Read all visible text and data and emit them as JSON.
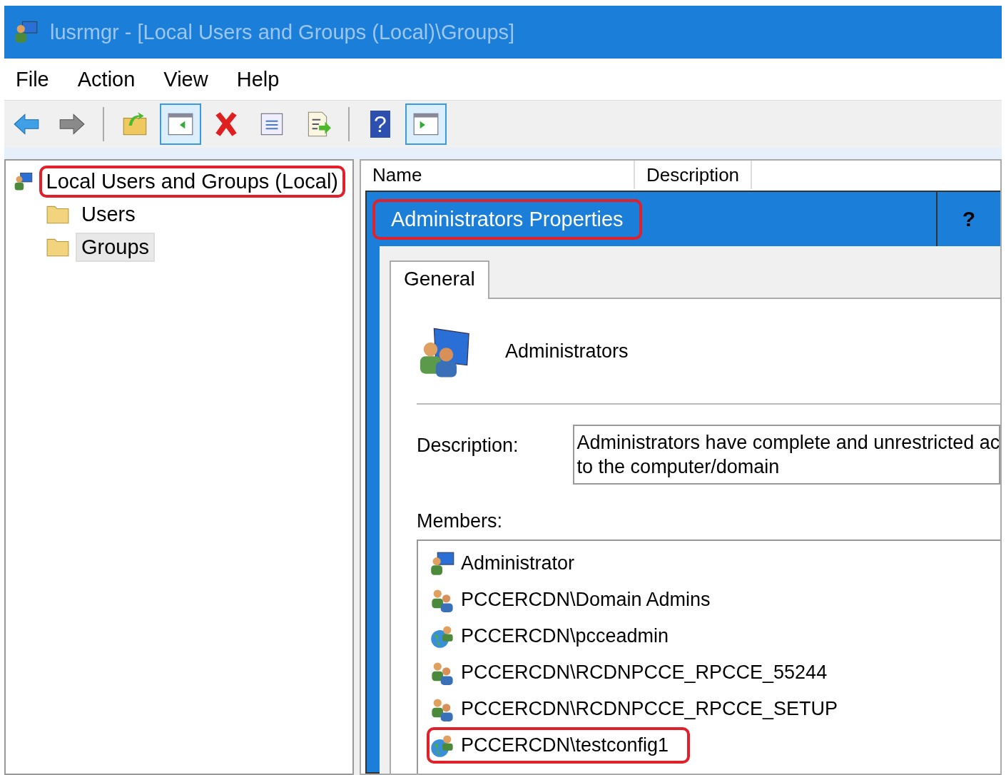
{
  "window": {
    "title": "lusrmgr - [Local Users and Groups (Local)\\Groups]"
  },
  "menu": [
    "File",
    "Action",
    "View",
    "Help"
  ],
  "toolbar": [
    [
      {
        "kind": "back",
        "pressed": false
      },
      {
        "kind": "forward",
        "pressed": false
      }
    ],
    [
      {
        "kind": "up",
        "pressed": false
      },
      {
        "kind": "tree",
        "pressed": true
      },
      {
        "kind": "delete",
        "pressed": false
      },
      {
        "kind": "properties",
        "pressed": false
      },
      {
        "kind": "export",
        "pressed": false
      }
    ],
    [
      {
        "kind": "help",
        "pressed": false,
        "glyph": "?"
      },
      {
        "kind": "action",
        "pressed": true
      }
    ]
  ],
  "tree": {
    "label": "Local Users and Groups (Local)",
    "annotated": true,
    "selected": false,
    "children": [
      {
        "label": "Users",
        "selected": false,
        "annotated": false
      },
      {
        "label": "Groups",
        "selected": true,
        "annotated": false
      }
    ]
  },
  "list": {
    "columns": [
      "Name",
      "Description"
    ]
  },
  "dialog": {
    "title": "Administrators Properties",
    "title_annotated": true,
    "help": "?",
    "tabs": [
      {
        "label": "General",
        "selected": true
      }
    ],
    "group_name": "Administrators",
    "description_label": "Description:",
    "description_lines": [
      "Administrators have complete and unrestricted ac",
      "to the computer/domain"
    ],
    "members_label": "Members:",
    "members": [
      {
        "kind": "user",
        "name": "Administrator",
        "annotated": false
      },
      {
        "kind": "group",
        "name": "PCCERCDN\\Domain Admins",
        "annotated": false
      },
      {
        "kind": "domain-user",
        "name": "PCCERCDN\\pcceadmin",
        "annotated": false
      },
      {
        "kind": "group",
        "name": "PCCERCDN\\RCDNPCCE_RPCCE_55244",
        "annotated": false
      },
      {
        "kind": "group",
        "name": "PCCERCDN\\RCDNPCCE_RPCCE_SETUP",
        "annotated": false
      },
      {
        "kind": "domain-user",
        "name": "PCCERCDN\\testconfig1",
        "annotated": true
      }
    ]
  }
}
